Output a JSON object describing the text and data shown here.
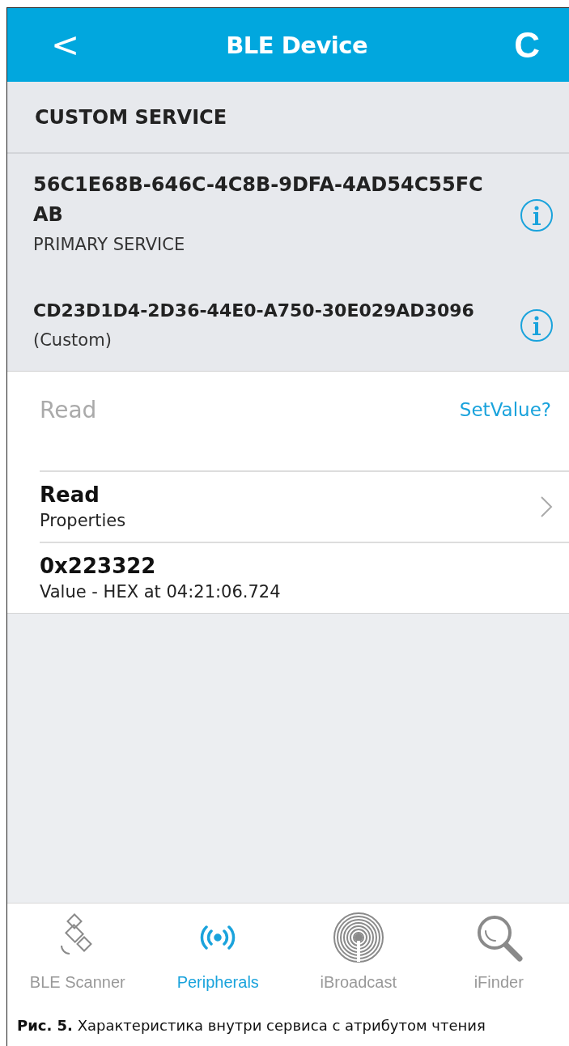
{
  "header": {
    "back": "<",
    "title": "BLE Device",
    "action": "C"
  },
  "section_title": "CUSTOM SERVICE",
  "services": [
    {
      "uuid": "56C1E68B-646C-4C8B-9DFA-4AD54C55FCAB",
      "subtitle": "PRIMARY SERVICE"
    },
    {
      "uuid": "CD23D1D4-2D36-44E0-A750-30E029AD3096",
      "subtitle": "(Custom)"
    }
  ],
  "characteristic": {
    "label": "Read",
    "action": "SetValue?",
    "rows": [
      {
        "title": "Read",
        "subtitle": "Properties",
        "chevron": true
      },
      {
        "title": "0x223322",
        "subtitle": "Value - HEX at 04:21:06.724",
        "chevron": false
      }
    ]
  },
  "tabs": [
    {
      "label": "BLE Scanner",
      "selected": false
    },
    {
      "label": "Peripherals",
      "selected": true
    },
    {
      "label": "iBroadcast",
      "selected": false
    },
    {
      "label": "iFinder",
      "selected": false
    }
  ],
  "caption": "**Рис. 5.** Характеристика внутри сервиса с атрибутом чтения"
}
